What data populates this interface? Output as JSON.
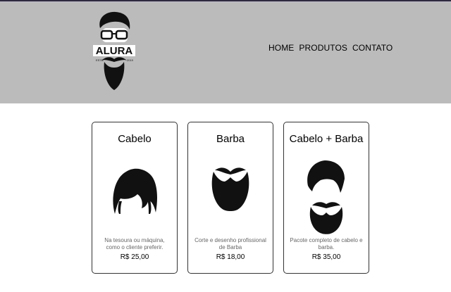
{
  "header": {
    "logo": {
      "text": "ALURA",
      "left_year": "ESTD",
      "right_year": "2019",
      "icon": "bearded-man-logo-icon"
    },
    "nav": [
      {
        "label": "HOME"
      },
      {
        "label": "PRODUTOS"
      },
      {
        "label": "CONTATO"
      }
    ]
  },
  "products": [
    {
      "title": "Cabelo",
      "icon": "hair-icon",
      "description": "Na tesoura ou máquina, como o cliente preferir.",
      "price": "R$ 25,00"
    },
    {
      "title": "Barba",
      "icon": "beard-icon",
      "description": "Corte e desenho profissional de Barba",
      "price": "R$ 18,00"
    },
    {
      "title": "Cabelo + Barba",
      "icon": "hair-and-beard-icon",
      "description": "Pacote completo de cabelo e barba.",
      "price": "R$ 35,00"
    }
  ],
  "colors": {
    "header_bg": "#bbbbbb",
    "card_border": "#333333",
    "description_text": "#666666"
  }
}
